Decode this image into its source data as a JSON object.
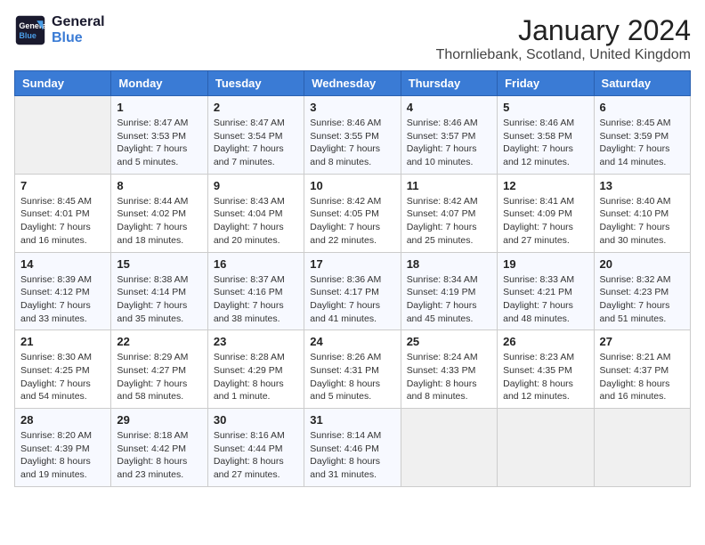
{
  "header": {
    "logo_line1": "General",
    "logo_line2": "Blue",
    "month": "January 2024",
    "location": "Thornliebank, Scotland, United Kingdom"
  },
  "weekdays": [
    "Sunday",
    "Monday",
    "Tuesday",
    "Wednesday",
    "Thursday",
    "Friday",
    "Saturday"
  ],
  "weeks": [
    [
      {
        "day": "",
        "info": ""
      },
      {
        "day": "1",
        "info": "Sunrise: 8:47 AM\nSunset: 3:53 PM\nDaylight: 7 hours\nand 5 minutes."
      },
      {
        "day": "2",
        "info": "Sunrise: 8:47 AM\nSunset: 3:54 PM\nDaylight: 7 hours\nand 7 minutes."
      },
      {
        "day": "3",
        "info": "Sunrise: 8:46 AM\nSunset: 3:55 PM\nDaylight: 7 hours\nand 8 minutes."
      },
      {
        "day": "4",
        "info": "Sunrise: 8:46 AM\nSunset: 3:57 PM\nDaylight: 7 hours\nand 10 minutes."
      },
      {
        "day": "5",
        "info": "Sunrise: 8:46 AM\nSunset: 3:58 PM\nDaylight: 7 hours\nand 12 minutes."
      },
      {
        "day": "6",
        "info": "Sunrise: 8:45 AM\nSunset: 3:59 PM\nDaylight: 7 hours\nand 14 minutes."
      }
    ],
    [
      {
        "day": "7",
        "info": "Sunrise: 8:45 AM\nSunset: 4:01 PM\nDaylight: 7 hours\nand 16 minutes."
      },
      {
        "day": "8",
        "info": "Sunrise: 8:44 AM\nSunset: 4:02 PM\nDaylight: 7 hours\nand 18 minutes."
      },
      {
        "day": "9",
        "info": "Sunrise: 8:43 AM\nSunset: 4:04 PM\nDaylight: 7 hours\nand 20 minutes."
      },
      {
        "day": "10",
        "info": "Sunrise: 8:42 AM\nSunset: 4:05 PM\nDaylight: 7 hours\nand 22 minutes."
      },
      {
        "day": "11",
        "info": "Sunrise: 8:42 AM\nSunset: 4:07 PM\nDaylight: 7 hours\nand 25 minutes."
      },
      {
        "day": "12",
        "info": "Sunrise: 8:41 AM\nSunset: 4:09 PM\nDaylight: 7 hours\nand 27 minutes."
      },
      {
        "day": "13",
        "info": "Sunrise: 8:40 AM\nSunset: 4:10 PM\nDaylight: 7 hours\nand 30 minutes."
      }
    ],
    [
      {
        "day": "14",
        "info": "Sunrise: 8:39 AM\nSunset: 4:12 PM\nDaylight: 7 hours\nand 33 minutes."
      },
      {
        "day": "15",
        "info": "Sunrise: 8:38 AM\nSunset: 4:14 PM\nDaylight: 7 hours\nand 35 minutes."
      },
      {
        "day": "16",
        "info": "Sunrise: 8:37 AM\nSunset: 4:16 PM\nDaylight: 7 hours\nand 38 minutes."
      },
      {
        "day": "17",
        "info": "Sunrise: 8:36 AM\nSunset: 4:17 PM\nDaylight: 7 hours\nand 41 minutes."
      },
      {
        "day": "18",
        "info": "Sunrise: 8:34 AM\nSunset: 4:19 PM\nDaylight: 7 hours\nand 45 minutes."
      },
      {
        "day": "19",
        "info": "Sunrise: 8:33 AM\nSunset: 4:21 PM\nDaylight: 7 hours\nand 48 minutes."
      },
      {
        "day": "20",
        "info": "Sunrise: 8:32 AM\nSunset: 4:23 PM\nDaylight: 7 hours\nand 51 minutes."
      }
    ],
    [
      {
        "day": "21",
        "info": "Sunrise: 8:30 AM\nSunset: 4:25 PM\nDaylight: 7 hours\nand 54 minutes."
      },
      {
        "day": "22",
        "info": "Sunrise: 8:29 AM\nSunset: 4:27 PM\nDaylight: 7 hours\nand 58 minutes."
      },
      {
        "day": "23",
        "info": "Sunrise: 8:28 AM\nSunset: 4:29 PM\nDaylight: 8 hours\nand 1 minute."
      },
      {
        "day": "24",
        "info": "Sunrise: 8:26 AM\nSunset: 4:31 PM\nDaylight: 8 hours\nand 5 minutes."
      },
      {
        "day": "25",
        "info": "Sunrise: 8:24 AM\nSunset: 4:33 PM\nDaylight: 8 hours\nand 8 minutes."
      },
      {
        "day": "26",
        "info": "Sunrise: 8:23 AM\nSunset: 4:35 PM\nDaylight: 8 hours\nand 12 minutes."
      },
      {
        "day": "27",
        "info": "Sunrise: 8:21 AM\nSunset: 4:37 PM\nDaylight: 8 hours\nand 16 minutes."
      }
    ],
    [
      {
        "day": "28",
        "info": "Sunrise: 8:20 AM\nSunset: 4:39 PM\nDaylight: 8 hours\nand 19 minutes."
      },
      {
        "day": "29",
        "info": "Sunrise: 8:18 AM\nSunset: 4:42 PM\nDaylight: 8 hours\nand 23 minutes."
      },
      {
        "day": "30",
        "info": "Sunrise: 8:16 AM\nSunset: 4:44 PM\nDaylight: 8 hours\nand 27 minutes."
      },
      {
        "day": "31",
        "info": "Sunrise: 8:14 AM\nSunset: 4:46 PM\nDaylight: 8 hours\nand 31 minutes."
      },
      {
        "day": "",
        "info": ""
      },
      {
        "day": "",
        "info": ""
      },
      {
        "day": "",
        "info": ""
      }
    ]
  ]
}
